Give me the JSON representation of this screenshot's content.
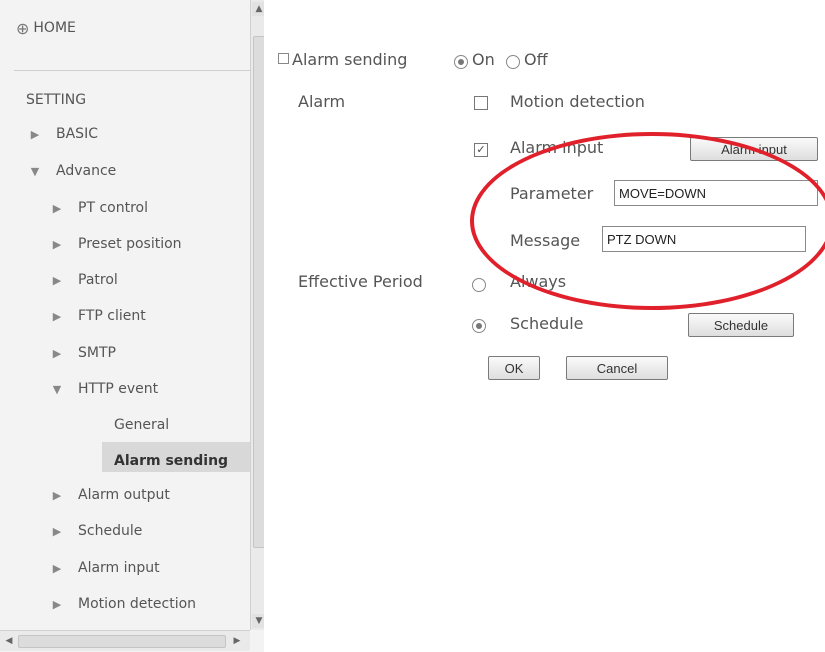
{
  "sidebar": {
    "home_label": "HOME",
    "setting_label": "SETTING",
    "items": [
      {
        "label": "BASIC",
        "arrow": "▶"
      },
      {
        "label": "Advance",
        "arrow": "▼"
      },
      {
        "label": "PT control",
        "arrow": "▶"
      },
      {
        "label": "Preset position",
        "arrow": "▶"
      },
      {
        "label": "Patrol",
        "arrow": "▶"
      },
      {
        "label": "FTP client",
        "arrow": "▶"
      },
      {
        "label": "SMTP",
        "arrow": "▶"
      },
      {
        "label": "HTTP event",
        "arrow": "▼"
      },
      {
        "label": "General"
      },
      {
        "label": "Alarm sending"
      },
      {
        "label": "Alarm output",
        "arrow": "▶"
      },
      {
        "label": "Schedule",
        "arrow": "▶"
      },
      {
        "label": "Alarm input",
        "arrow": "▶"
      },
      {
        "label": "Motion detection",
        "arrow": "▶"
      }
    ],
    "selected_item": "Alarm sending"
  },
  "form": {
    "alarm_sending_label": "Alarm sending",
    "on_label": "On",
    "off_label": "Off",
    "alarm_sending_value": "On",
    "alarm_label": "Alarm",
    "motion_detection_label": "Motion detection",
    "motion_detection_checked": false,
    "alarm_input_label": "Alarm input",
    "alarm_input_checked": true,
    "alarm_input_button": "Alarm input",
    "parameter_label": "Parameter",
    "parameter_value": "MOVE=DOWN",
    "message_label": "Message",
    "message_value": "PTZ DOWN",
    "effective_period_label": "Effective Period",
    "always_label": "Always",
    "schedule_label": "Schedule",
    "effective_period_value": "Schedule",
    "schedule_button": "Schedule",
    "ok_button": "OK",
    "cancel_button": "Cancel"
  },
  "colors": {
    "annotation": "#e0202a",
    "selected_bg": "#d8d8d8"
  }
}
